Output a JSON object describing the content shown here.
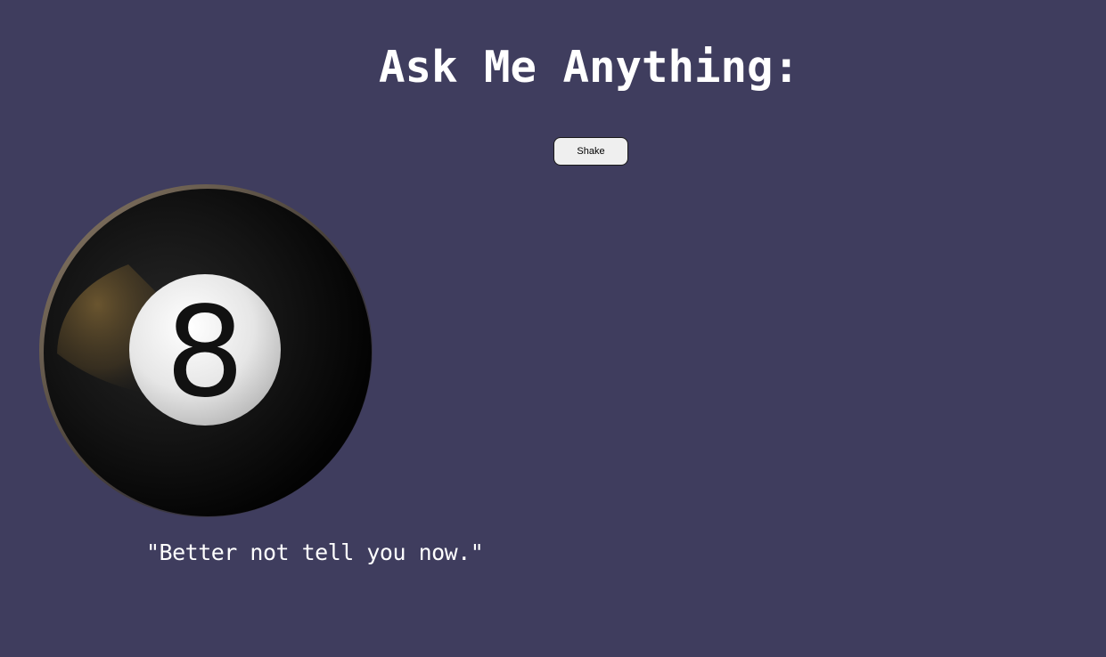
{
  "header": {
    "title": "Ask Me Anything:"
  },
  "controls": {
    "shake_label": "Shake"
  },
  "ball": {
    "number": "8",
    "icon": "magic-8-ball-icon"
  },
  "answer": {
    "text": "\"Better not tell you now.\""
  },
  "colors": {
    "background": "#3f3d5e",
    "text": "#ffffff",
    "button_bg": "#efefef"
  }
}
